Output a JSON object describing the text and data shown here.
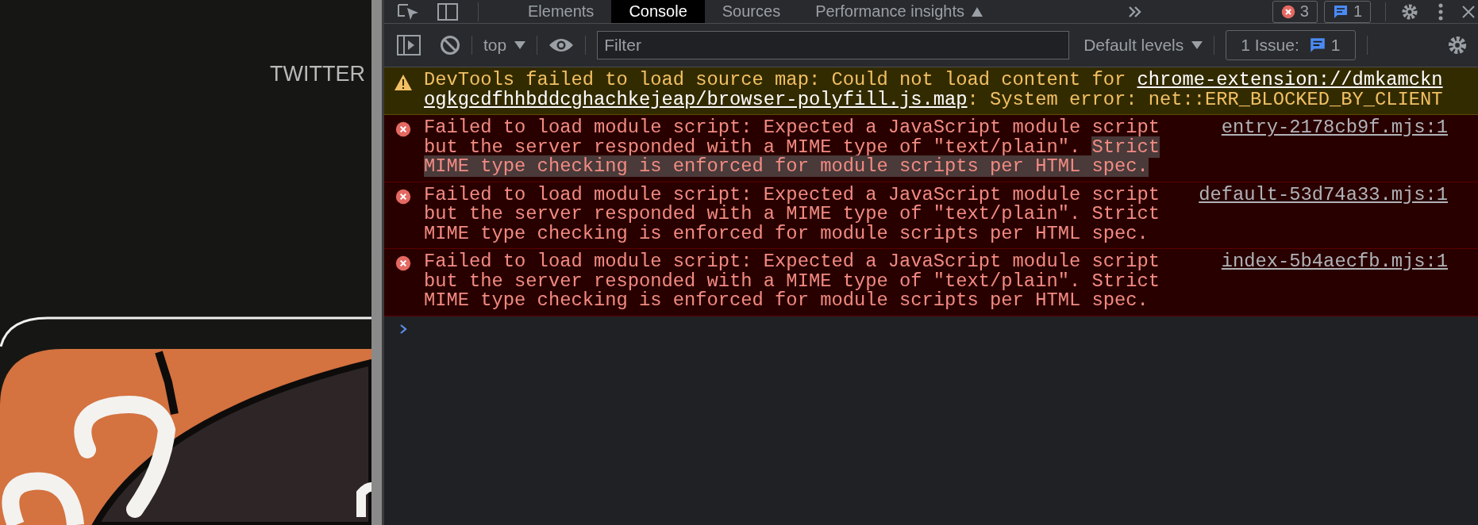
{
  "page": {
    "label": "TWITTER"
  },
  "devtools": {
    "tabs": [
      {
        "label": "Elements",
        "selected": false
      },
      {
        "label": "Console",
        "selected": true
      },
      {
        "label": "Sources",
        "selected": false
      },
      {
        "label": "Performance insights",
        "selected": false
      }
    ],
    "error_count": "3",
    "issue_count": "1",
    "toolbar": {
      "context": "top",
      "filter": {
        "placeholder": "Filter"
      },
      "levels": "Default levels",
      "issues": {
        "label": "1 Issue:",
        "count": "1"
      }
    },
    "messages": [
      {
        "kind": "warning",
        "segments": [
          {
            "kind": "text",
            "text": "DevTools failed to load source map: Could not load content for "
          },
          {
            "kind": "link",
            "text": "chrome-extension://dmkamcknogkgcdfhhbddcghachkejeap/browser-polyfill.js.map"
          },
          {
            "kind": "text",
            "text": ": System error: net::ERR_BLOCKED_BY_CLIENT"
          }
        ]
      },
      {
        "kind": "error",
        "source": "entry-2178cb9f.mjs:1",
        "segments": [
          {
            "kind": "text",
            "text": "Failed to load module script: Expected a JavaScript module script but the server responded with a MIME type of \"text/plain\". "
          },
          {
            "kind": "match",
            "text": "Strict MIME type checking is enforced for module scripts per HTML spec."
          }
        ]
      },
      {
        "kind": "error",
        "source": "default-53d74a33.mjs:1",
        "segments": [
          {
            "kind": "text",
            "text": "Failed to load module script: Expected a JavaScript module script but the server responded with a MIME type of \"text/plain\". Strict MIME type checking is enforced for module scripts per HTML spec."
          }
        ]
      },
      {
        "kind": "error",
        "source": "index-5b4aecfb.mjs:1",
        "segments": [
          {
            "kind": "text",
            "text": "Failed to load module script: Expected a JavaScript module script but the server responded with a MIME type of \"text/plain\". Strict MIME type checking is enforced for module scripts per HTML spec."
          }
        ]
      }
    ]
  }
}
